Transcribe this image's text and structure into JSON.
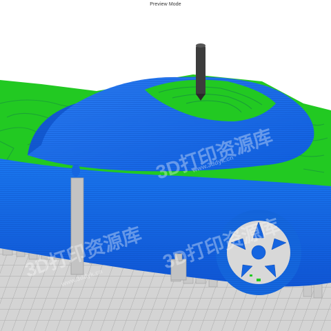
{
  "window": {
    "title": "Preview Mode"
  },
  "viewport": {
    "mode": "layer-preview",
    "colors": {
      "outer_wall": "#1565e0",
      "inner_wall": "#1e88ff",
      "top_skin": "#22c922",
      "support": "#c8c8c8",
      "bed": "#d2d2d2",
      "grid_line": "#a9a9a9",
      "nozzle": "#3c3c3c"
    },
    "watermark": {
      "text": "3D打印资源库",
      "url": "www.3ddyk.cn"
    }
  }
}
